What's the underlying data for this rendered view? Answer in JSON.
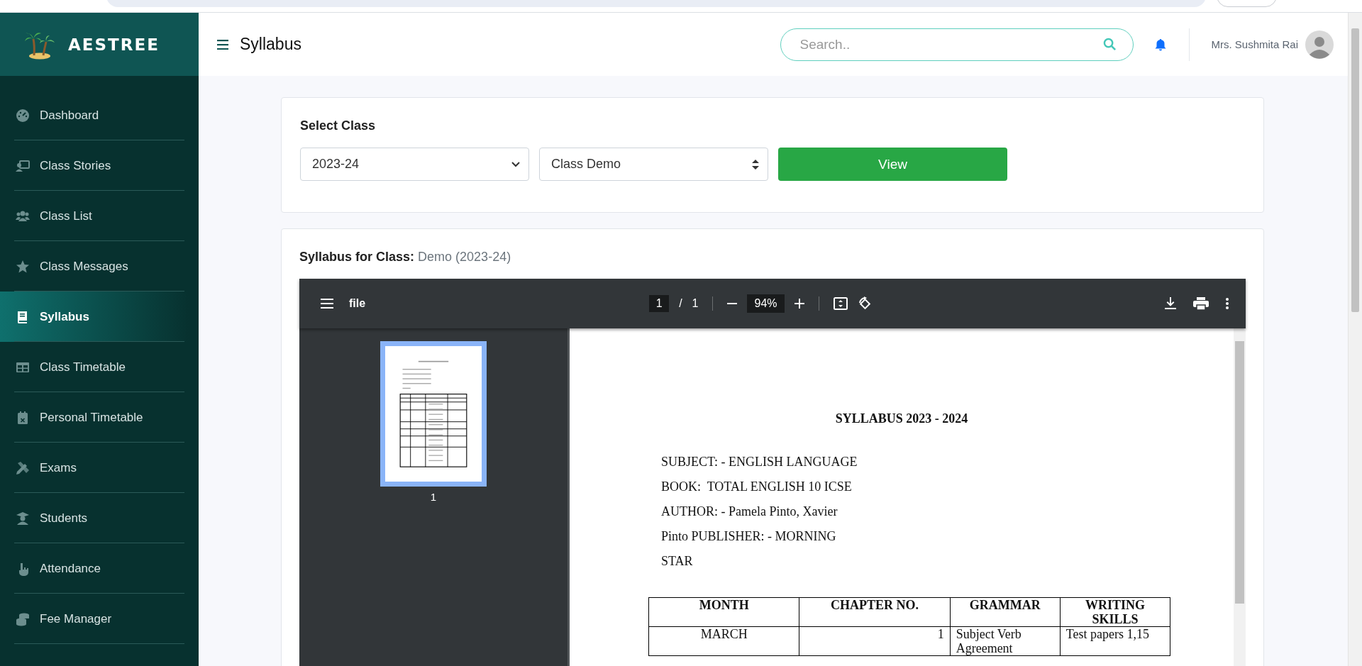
{
  "brand": {
    "name": "AESTREE"
  },
  "header": {
    "title": "Syllabus",
    "search": {
      "placeholder": "Search.."
    },
    "user": {
      "name": "Mrs. Sushmita Rai"
    }
  },
  "sidebar": {
    "items": [
      {
        "label": "Dashboard",
        "selected": false
      },
      {
        "label": "Class Stories",
        "selected": false
      },
      {
        "label": "Class List",
        "selected": false
      },
      {
        "label": "Class Messages",
        "selected": false
      },
      {
        "label": "Syllabus",
        "selected": true
      },
      {
        "label": "Class Timetable",
        "selected": false
      },
      {
        "label": "Personal Timetable",
        "selected": false
      },
      {
        "label": "Exams",
        "selected": false
      },
      {
        "label": "Students",
        "selected": false
      },
      {
        "label": "Attendance",
        "selected": false
      },
      {
        "label": "Fee Manager",
        "selected": false
      }
    ]
  },
  "select_class": {
    "title": "Select Class",
    "year": "2023-24",
    "class": "Class Demo",
    "button": "View"
  },
  "syllabus": {
    "label": "Syllabus for Class:",
    "value": "Demo (2023-24)",
    "viewer": {
      "file_name": "file",
      "page": "1",
      "separator": "/",
      "page_total": "1",
      "zoom": "94%",
      "thumbnail_label": "1",
      "document": {
        "title": "SYLLABUS 2023 - 2024",
        "lines": [
          "SUBJECT: - ENGLISH LANGUAGE",
          "BOOK:  TOTAL ENGLISH 10 ICSE",
          "AUTHOR: - Pamela Pinto, Xavier",
          "Pinto PUBLISHER: - MORNING",
          "STAR"
        ],
        "table": {
          "columns": [
            "MONTH",
            "CHAPTER NO.",
            "GRAMMAR",
            "WRITING SKILLS"
          ],
          "rows": [
            [
              "MARCH",
              "1",
              "Subject Verb Agreement",
              "Test papers 1,15"
            ]
          ]
        }
      }
    }
  }
}
